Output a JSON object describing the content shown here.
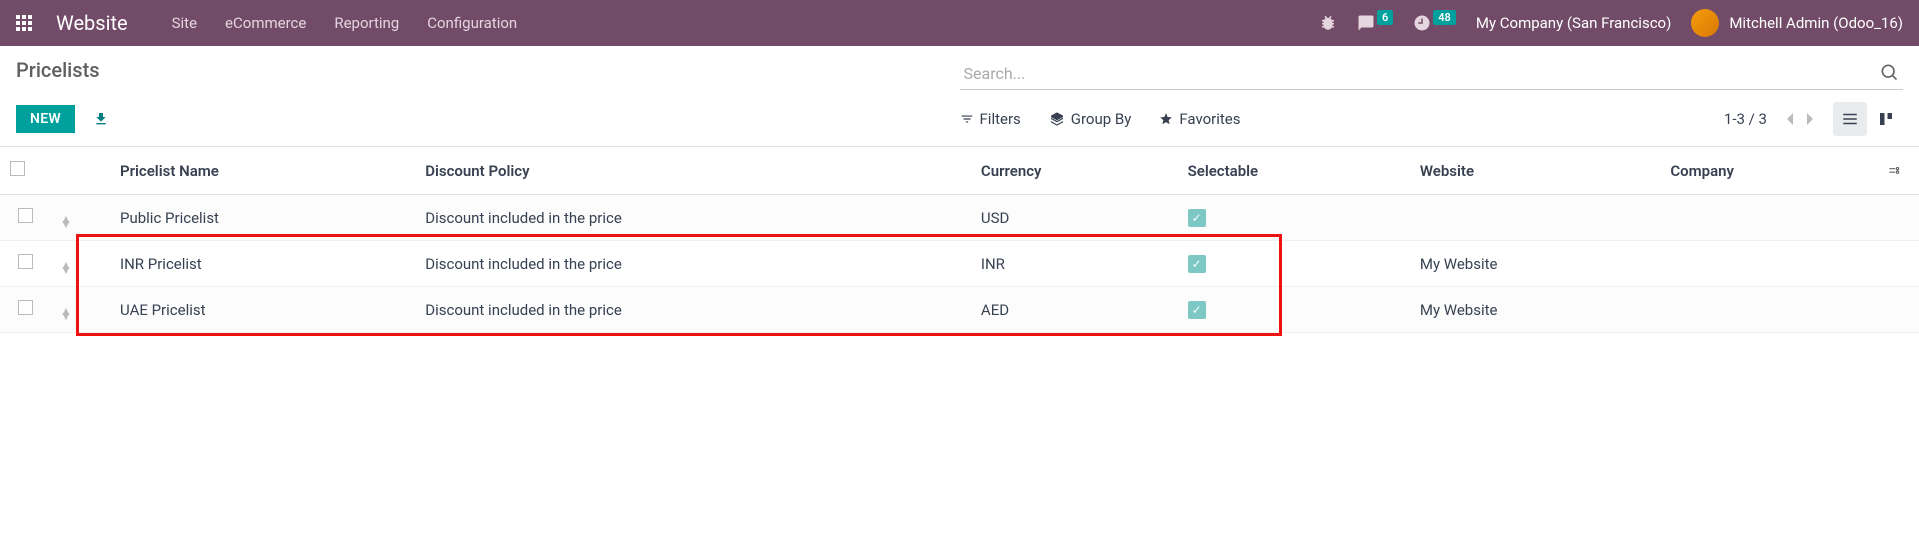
{
  "navbar": {
    "app_name": "Website",
    "menu": [
      "Site",
      "eCommerce",
      "Reporting",
      "Configuration"
    ],
    "messages_badge": "6",
    "activities_badge": "48",
    "company": "My Company (San Francisco)",
    "user": "Mitchell Admin (Odoo_16)"
  },
  "breadcrumb": "Pricelists",
  "buttons": {
    "new": "NEW"
  },
  "search": {
    "placeholder": "Search...",
    "filters": "Filters",
    "group_by": "Group By",
    "favorites": "Favorites"
  },
  "pager": "1-3 / 3",
  "columns": {
    "name": "Pricelist Name",
    "discount_policy": "Discount Policy",
    "currency": "Currency",
    "selectable": "Selectable",
    "website": "Website",
    "company": "Company"
  },
  "rows": [
    {
      "name": "Public Pricelist",
      "discount_policy": "Discount included in the price",
      "currency": "USD",
      "selectable": true,
      "website": "",
      "company": ""
    },
    {
      "name": "INR Pricelist",
      "discount_policy": "Discount included in the price",
      "currency": "INR",
      "selectable": true,
      "website": "My Website",
      "company": ""
    },
    {
      "name": "UAE Pricelist",
      "discount_policy": "Discount included in the price",
      "currency": "AED",
      "selectable": true,
      "website": "My Website",
      "company": ""
    }
  ]
}
